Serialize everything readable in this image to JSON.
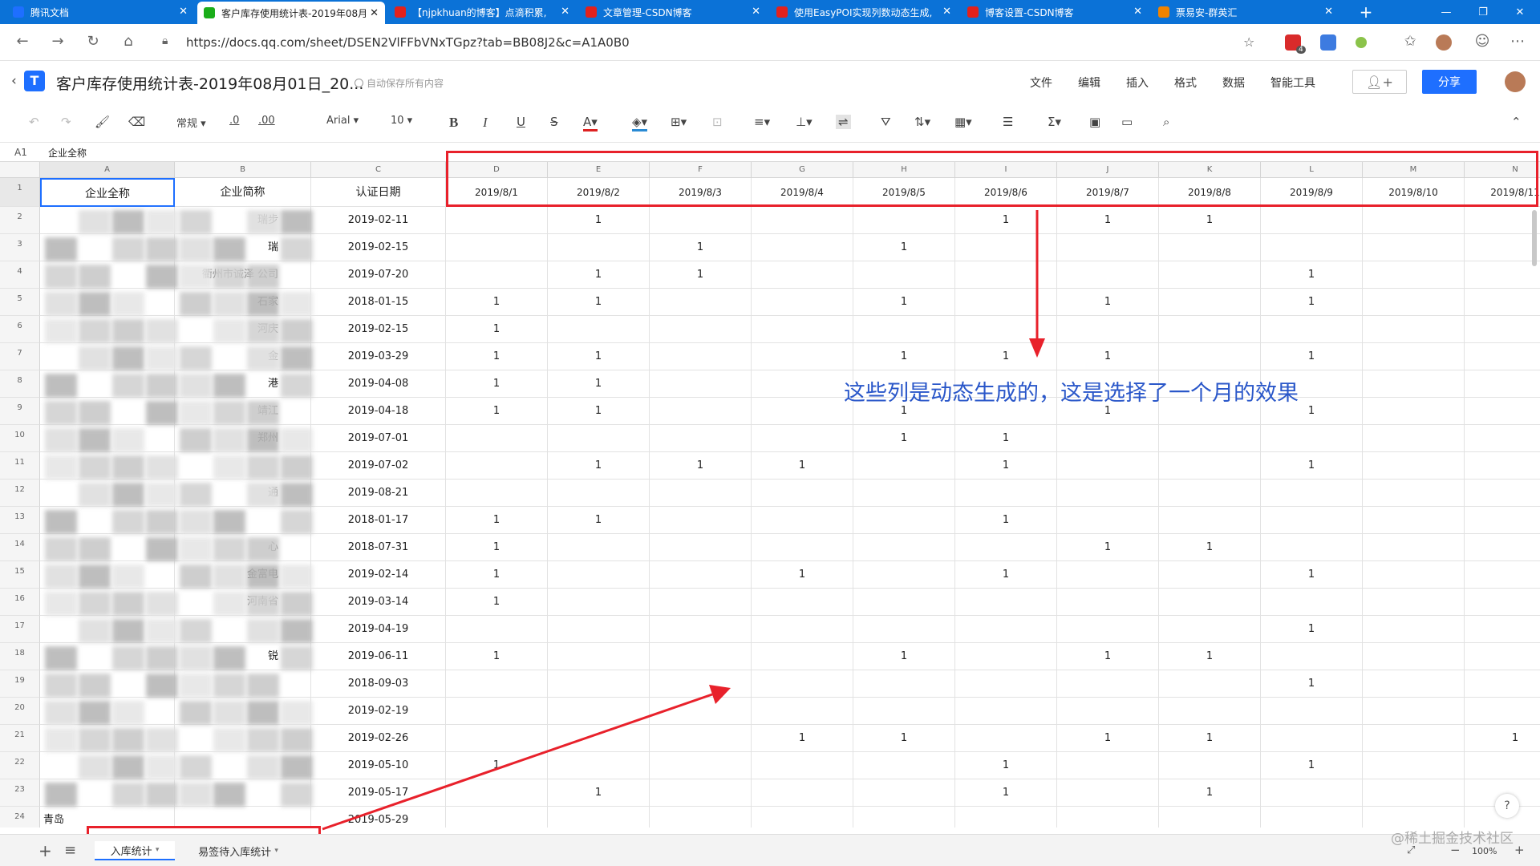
{
  "browser": {
    "tabs": [
      {
        "label": "腾讯文档",
        "active": false,
        "favicon_color": "#1e6fff",
        "icon": "tencent-docs-icon"
      },
      {
        "label": "客户库存使用统计表-2019年08月",
        "active": true,
        "favicon_color": "#1aad19",
        "icon": "sheet-icon"
      },
      {
        "label": "【njpkhuan的博客】点滴积累,",
        "active": false,
        "favicon_color": "#e2211c",
        "icon": "csdn-icon"
      },
      {
        "label": "文章管理-CSDN博客",
        "active": false,
        "favicon_color": "#e2211c",
        "icon": "csdn-icon"
      },
      {
        "label": "使用EasyPOI实现列数动态生成,",
        "active": false,
        "favicon_color": "#e2211c",
        "icon": "csdn-icon"
      },
      {
        "label": "博客设置-CSDN博客",
        "active": false,
        "favicon_color": "#e2211c",
        "icon": "csdn-icon"
      },
      {
        "label": "票易安-群英汇",
        "active": false,
        "favicon_color": "#f08300",
        "icon": "piaoyian-icon"
      }
    ],
    "new_tab": "+",
    "url": "https://docs.qq.com/sheet/DSEN2VlFFbVNxTGpz?tab=BB08J2&c=A1A0B0",
    "badge_count": "4"
  },
  "doc": {
    "title": "客户库存使用统计表-2019年08月01日_20...",
    "autosave": "自动保存所有内容",
    "menu": [
      "文件",
      "编辑",
      "插入",
      "格式",
      "数据",
      "智能工具"
    ],
    "share_label": "分享"
  },
  "toolbar": {
    "format": "常规",
    "dec_less": ".0",
    "dec_more": ".00",
    "font": "Arial",
    "size": "10"
  },
  "formula": {
    "ref": "A1",
    "value": "企业全称"
  },
  "sheet": {
    "col_letters": [
      "A",
      "B",
      "C",
      "D",
      "E",
      "F",
      "G",
      "H",
      "I",
      "J",
      "K",
      "L",
      "M",
      "N"
    ],
    "headers": [
      "企业全称",
      "企业简称",
      "认证日期",
      "2019/8/1",
      "2019/8/2",
      "2019/8/3",
      "2019/8/4",
      "2019/8/5",
      "2019/8/6",
      "2019/8/7",
      "2019/8/8",
      "2019/8/9",
      "2019/8/10",
      "2019/8/11"
    ],
    "rows": [
      {
        "n": "2",
        "a": "",
        "b": "瑞步",
        "c": "2019-02-11",
        "v": [
          "",
          "1",
          "",
          "",
          "",
          "1",
          "1",
          "1",
          "",
          "",
          ""
        ]
      },
      {
        "n": "3",
        "a": "",
        "b": "瑞",
        "c": "2019-02-15",
        "v": [
          "",
          "",
          "1",
          "",
          "1",
          "",
          "",
          "",
          "",
          "",
          ""
        ]
      },
      {
        "n": "4",
        "a": "",
        "b": "衢州市诚泽 公司",
        "c": "2019-07-20",
        "v": [
          "",
          "1",
          "1",
          "",
          "",
          "",
          "",
          "",
          "1",
          "",
          ""
        ]
      },
      {
        "n": "5",
        "a": "",
        "b": "石家",
        "c": "2018-01-15",
        "v": [
          "1",
          "1",
          "",
          "",
          "1",
          "",
          "1",
          "",
          "1",
          "",
          ""
        ]
      },
      {
        "n": "6",
        "a": "",
        "b": "河庆",
        "c": "2019-02-15",
        "v": [
          "1",
          "",
          "",
          "",
          "",
          "",
          "",
          "",
          "",
          "",
          ""
        ]
      },
      {
        "n": "7",
        "a": "",
        "b": "金",
        "c": "2019-03-29",
        "v": [
          "1",
          "1",
          "",
          "",
          "1",
          "1",
          "1",
          "",
          "1",
          "",
          ""
        ]
      },
      {
        "n": "8",
        "a": "",
        "b": "港",
        "c": "2019-04-08",
        "v": [
          "1",
          "1",
          "",
          "",
          "",
          "",
          "",
          "",
          "",
          "",
          ""
        ]
      },
      {
        "n": "9",
        "a": "",
        "b": "靖江",
        "c": "2019-04-18",
        "v": [
          "1",
          "1",
          "",
          "",
          "1",
          "",
          "1",
          "",
          "1",
          "",
          ""
        ]
      },
      {
        "n": "10",
        "a": "",
        "b": "郑州",
        "c": "2019-07-01",
        "v": [
          "",
          "",
          "",
          "",
          "1",
          "1",
          "",
          "",
          "",
          "",
          ""
        ]
      },
      {
        "n": "11",
        "a": "",
        "b": "",
        "c": "2019-07-02",
        "v": [
          "",
          "1",
          "1",
          "1",
          "",
          "1",
          "",
          "",
          "1",
          "",
          ""
        ]
      },
      {
        "n": "12",
        "a": "",
        "b": "通",
        "c": "2019-08-21",
        "v": [
          "",
          "",
          "",
          "",
          "",
          "",
          "",
          "",
          "",
          "",
          ""
        ]
      },
      {
        "n": "13",
        "a": "",
        "b": "",
        "c": "2018-01-17",
        "v": [
          "1",
          "1",
          "",
          "",
          "",
          "1",
          "",
          "",
          "",
          "",
          ""
        ]
      },
      {
        "n": "14",
        "a": "",
        "b": "心",
        "c": "2018-07-31",
        "v": [
          "1",
          "",
          "",
          "",
          "",
          "",
          "1",
          "1",
          "",
          "",
          ""
        ]
      },
      {
        "n": "15",
        "a": "",
        "b": "金富电",
        "c": "2019-02-14",
        "v": [
          "1",
          "",
          "",
          "1",
          "",
          "1",
          "",
          "",
          "1",
          "",
          ""
        ]
      },
      {
        "n": "16",
        "a": "",
        "b": "河南省",
        "c": "2019-03-14",
        "v": [
          "1",
          "",
          "",
          "",
          "",
          "",
          "",
          "",
          "",
          "",
          ""
        ]
      },
      {
        "n": "17",
        "a": "",
        "b": "",
        "c": "2019-04-19",
        "v": [
          "",
          "",
          "",
          "",
          "",
          "",
          "",
          "",
          "1",
          "",
          ""
        ]
      },
      {
        "n": "18",
        "a": "",
        "b": "锐",
        "c": "2019-06-11",
        "v": [
          "1",
          "",
          "",
          "",
          "1",
          "",
          "1",
          "1",
          "",
          "",
          ""
        ]
      },
      {
        "n": "19",
        "a": "",
        "b": "",
        "c": "2018-09-03",
        "v": [
          "",
          "",
          "",
          "",
          "",
          "",
          "",
          "",
          "1",
          "",
          ""
        ]
      },
      {
        "n": "20",
        "a": "",
        "b": "",
        "c": "2019-02-19",
        "v": [
          "",
          "",
          "",
          "",
          "",
          "",
          "",
          "",
          "",
          "",
          ""
        ]
      },
      {
        "n": "21",
        "a": "",
        "b": "",
        "c": "2019-02-26",
        "v": [
          "",
          "",
          "",
          "1",
          "1",
          "",
          "1",
          "1",
          "",
          "",
          "1"
        ]
      },
      {
        "n": "22",
        "a": "",
        "b": "",
        "c": "2019-05-10",
        "v": [
          "1",
          "",
          "",
          "",
          "",
          "1",
          "",
          "",
          "1",
          "",
          ""
        ]
      },
      {
        "n": "23",
        "a": "",
        "b": "",
        "c": "2019-05-17",
        "v": [
          "",
          "1",
          "",
          "",
          "",
          "1",
          "",
          "1",
          "",
          "",
          ""
        ]
      },
      {
        "n": "24",
        "a": "青岛",
        "b": "",
        "c": "2019-05-29",
        "v": [
          "",
          "",
          "",
          "",
          "",
          "",
          "",
          "",
          "",
          "",
          ""
        ]
      }
    ]
  },
  "annotation": {
    "text": "这些列是动态生成的，这是选择了一个月的效果"
  },
  "sheets": [
    "入库统计",
    "易签待入库统计"
  ],
  "zoom": "100%",
  "watermark": "@稀土掘金技术社区",
  "help": "?",
  "colors": {
    "tab_blue": "#0b72d7",
    "share_blue": "#1e6fff",
    "annotation_red": "#e8212b",
    "annotation_text": "#2a57c9"
  }
}
